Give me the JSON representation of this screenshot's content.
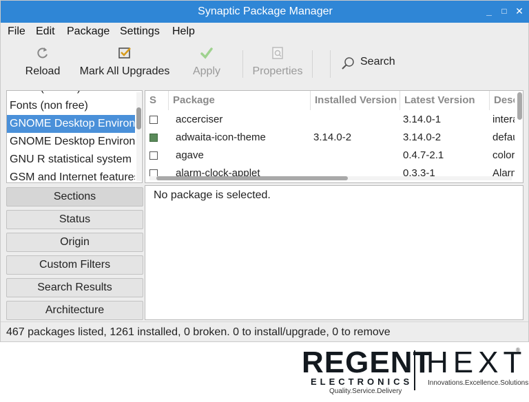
{
  "window": {
    "title": "Synaptic Package Manager",
    "controls": [
      "_",
      "□",
      "✕"
    ]
  },
  "menubar": [
    "File",
    "Edit",
    "Package",
    "Settings",
    "Help"
  ],
  "toolbar": {
    "reload": "Reload",
    "mark_all": "Mark All Upgrades",
    "apply": "Apply",
    "properties": "Properties",
    "search": "Search"
  },
  "sections_list": {
    "partial_top": "Fonts (contrib)",
    "items": [
      "Fonts (non free)",
      "GNOME Desktop Environme",
      "GNOME Desktop Environme",
      "GNU R statistical system",
      "GSM and Internet features"
    ],
    "selected_index": 1
  },
  "package_table": {
    "columns": [
      "S",
      "Package",
      "Installed Version",
      "Latest Version",
      "Description"
    ],
    "rows": [
      {
        "installed": false,
        "package": "accerciser",
        "installed_version": "",
        "latest_version": "3.14.0-1",
        "description": "interactive accessibility explorer"
      },
      {
        "installed": true,
        "package": "adwaita-icon-theme",
        "installed_version": "3.14.0-2",
        "latest_version": "3.14.0-2",
        "description": "default icon theme of GNOME"
      },
      {
        "installed": false,
        "package": "agave",
        "installed_version": "",
        "latest_version": "0.4.7-2.1",
        "description": "colorscheme designer"
      },
      {
        "installed": false,
        "package": "alarm-clock-applet",
        "installed_version": "",
        "latest_version": "0.3.3-1",
        "description": "Alarm Clock for GNOME"
      }
    ]
  },
  "details": {
    "message": "No package is selected."
  },
  "filters": [
    "Sections",
    "Status",
    "Origin",
    "Custom Filters",
    "Search Results",
    "Architecture"
  ],
  "status": "467 packages listed, 1261 installed, 0 broken. 0 to install/upgrade, 0 to remove",
  "logos": {
    "regent": "REGENT",
    "regent_sub": "ELECTRONICS",
    "regent_tag": "Quality.Service.Delivery",
    "hext": "HEXT",
    "hext_tag": "Innovations.Excellence.Solutions",
    "hext_mark": "®"
  },
  "colors": {
    "titlebar": "#2f86d6",
    "selection": "#4a90d9",
    "installed_box": "#5a8a5a",
    "window_bg": "#ededed"
  },
  "icons": [
    "reload-icon",
    "mark-upgrades-icon",
    "apply-check-icon",
    "properties-icon",
    "search-icon"
  ]
}
